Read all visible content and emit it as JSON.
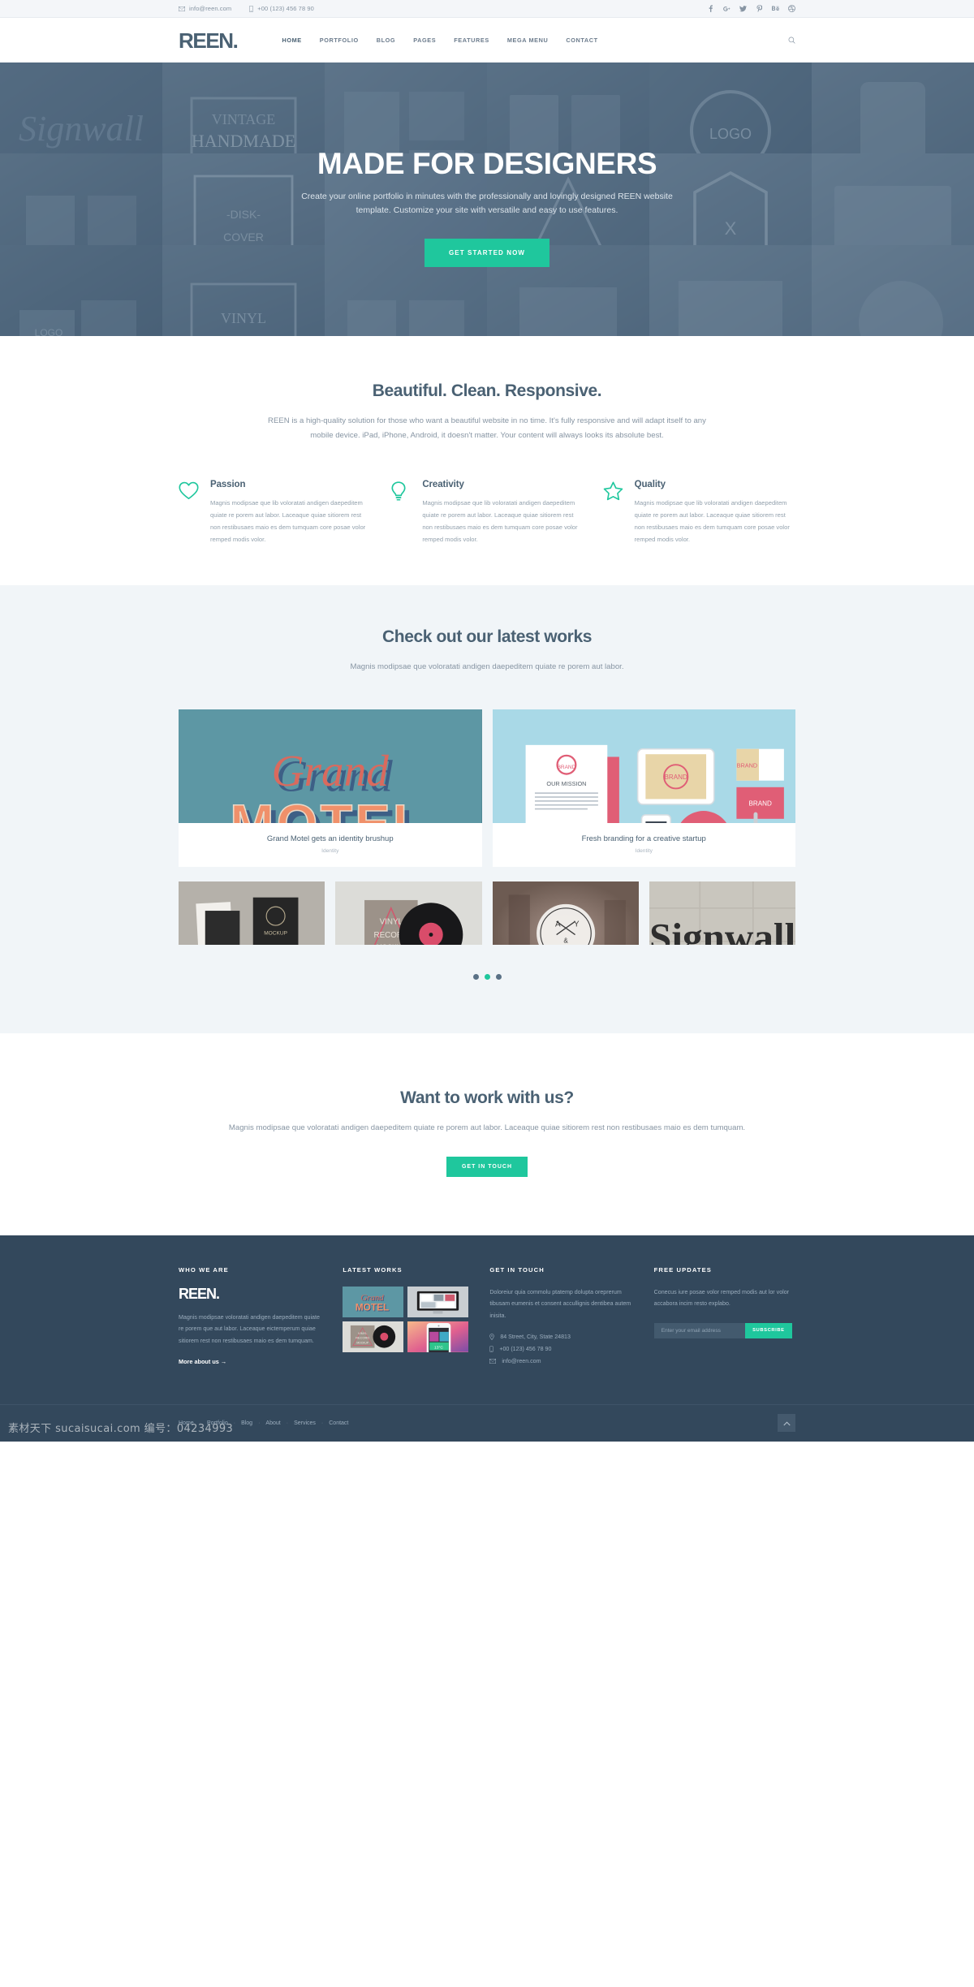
{
  "topbar": {
    "email": "info@reen.com",
    "phone": "+00 (123) 456 78 90",
    "social": [
      {
        "name": "facebook-icon",
        "glyph": "f"
      },
      {
        "name": "google-plus-icon",
        "glyph": "g+"
      },
      {
        "name": "twitter-icon",
        "glyph": "t"
      },
      {
        "name": "pinterest-icon",
        "glyph": "p"
      },
      {
        "name": "behance-icon",
        "glyph": "Be"
      },
      {
        "name": "dribbble-icon",
        "glyph": "d"
      }
    ]
  },
  "header": {
    "logo": "REEN.",
    "nav": [
      {
        "label": "HOME",
        "active": true
      },
      {
        "label": "PORTFOLIO",
        "active": false
      },
      {
        "label": "BLOG",
        "active": false
      },
      {
        "label": "PAGES",
        "active": false
      },
      {
        "label": "FEATURES",
        "active": false
      },
      {
        "label": "MEGA MENU",
        "active": false
      },
      {
        "label": "CONTACT",
        "active": false
      }
    ],
    "search_icon": "search-icon"
  },
  "hero": {
    "title": "MADE FOR DESIGNERS",
    "subtitle": "Create your online portfolio in minutes with the professionally and lovingly designed REEN website template. Customize your site with versatile and easy to use features.",
    "cta": "GET STARTED NOW"
  },
  "intro": {
    "title": "Beautiful. Clean. Responsive.",
    "subtitle": "REEN is a high-quality solution for those who want a beautiful website in no time. It's fully responsive and will adapt itself to any mobile device. iPad, iPhone, Android, it doesn't matter. Your content will always looks its absolute best.",
    "features": [
      {
        "icon": "heart-icon",
        "title": "Passion",
        "text": "Magnis modipsae que lib voloratati andigen daepeditem quiate re porem aut labor. Laceaque quiae sitiorem rest non restibusaes maio es dem tumquam core posae volor remped modis volor."
      },
      {
        "icon": "lightbulb-icon",
        "title": "Creativity",
        "text": "Magnis modipsae que lib voloratati andigen daepeditem quiate re porem aut labor. Laceaque quiae sitiorem rest non restibusaes maio es dem tumquam core posae volor remped modis volor."
      },
      {
        "icon": "star-icon",
        "title": "Quality",
        "text": "Magnis modipsae que lib voloratati andigen daepeditem quiate re porem aut labor. Laceaque quiae sitiorem rest non restibusaes maio es dem tumquam core posae volor remped modis volor."
      }
    ]
  },
  "works": {
    "title": "Check out our latest works",
    "subtitle": "Magnis modipsae que voloratati andigen daepeditem quiate re porem aut labor.",
    "cards": [
      {
        "title": "Grand Motel gets an identity brushup",
        "category": "Identity",
        "art": "grand-motel"
      },
      {
        "title": "Fresh branding for a creative startup",
        "category": "Identity",
        "art": "brand-stationery"
      }
    ],
    "thumbs": [
      {
        "name": "thumbnail-stationery-dark",
        "art": "stationery"
      },
      {
        "name": "thumbnail-vinyl-record",
        "art": "vinyl"
      },
      {
        "name": "thumbnail-badge-logo",
        "art": "badge"
      },
      {
        "name": "thumbnail-signwall",
        "art": "signwall"
      }
    ],
    "dots": [
      {
        "active": false
      },
      {
        "active": true
      },
      {
        "active": false
      }
    ]
  },
  "cta": {
    "title": "Want to work with us?",
    "subtitle": "Magnis modipsae que voloratati andigen daepeditem quiate re porem aut labor. Laceaque quiae sitiorem rest non restibusaes maio es dem tumquam.",
    "button": "GET IN TOUCH"
  },
  "footer": {
    "col1": {
      "heading": "WHO WE ARE",
      "logo": "REEN.",
      "text": "Magnis modipsae voloratati andigen daepeditem quiate re porem que aut labor. Laceaque eictemperum quiae sitiorem rest non restibusaes maio es dem tumquam.",
      "link": "More about us"
    },
    "col2": {
      "heading": "LATEST WORKS",
      "thumbs": [
        {
          "name": "footer-work-grand-motel",
          "art": "grand-motel"
        },
        {
          "name": "footer-work-imac",
          "art": "imac"
        },
        {
          "name": "footer-work-vinyl",
          "art": "vinyl"
        },
        {
          "name": "footer-work-iphone",
          "art": "iphone"
        }
      ]
    },
    "col3": {
      "heading": "GET IN TOUCH",
      "text": "Doloreiur quia commolu ptatemp dolupta oreprerum tibusam eumenis et consent accullignis dentibea autem inisita.",
      "address": "84 Street, City, State 24813",
      "phone": "+00 (123) 456 78 90",
      "email": "info@reen.com"
    },
    "col4": {
      "heading": "FREE UPDATES",
      "text": "Conecus iure posae volor remped modis aut lor volor accabora incim resto explabo.",
      "placeholder": "Enter your email address",
      "input_value": "",
      "button": "SUBSCRIBE"
    },
    "bottom_links": [
      "Home",
      "Portfolio",
      "Blog",
      "About",
      "Services",
      "Contact"
    ],
    "separator": "·",
    "to_top_icon": "chevron-up-icon"
  },
  "watermark": "素材天下 sucaisucai.com 编号：04234993",
  "colors": {
    "accent": "#1fc79d",
    "dark": "#33485c",
    "heading": "#4a6173",
    "body": "#8795a3",
    "light_bg": "#f1f5f8"
  }
}
